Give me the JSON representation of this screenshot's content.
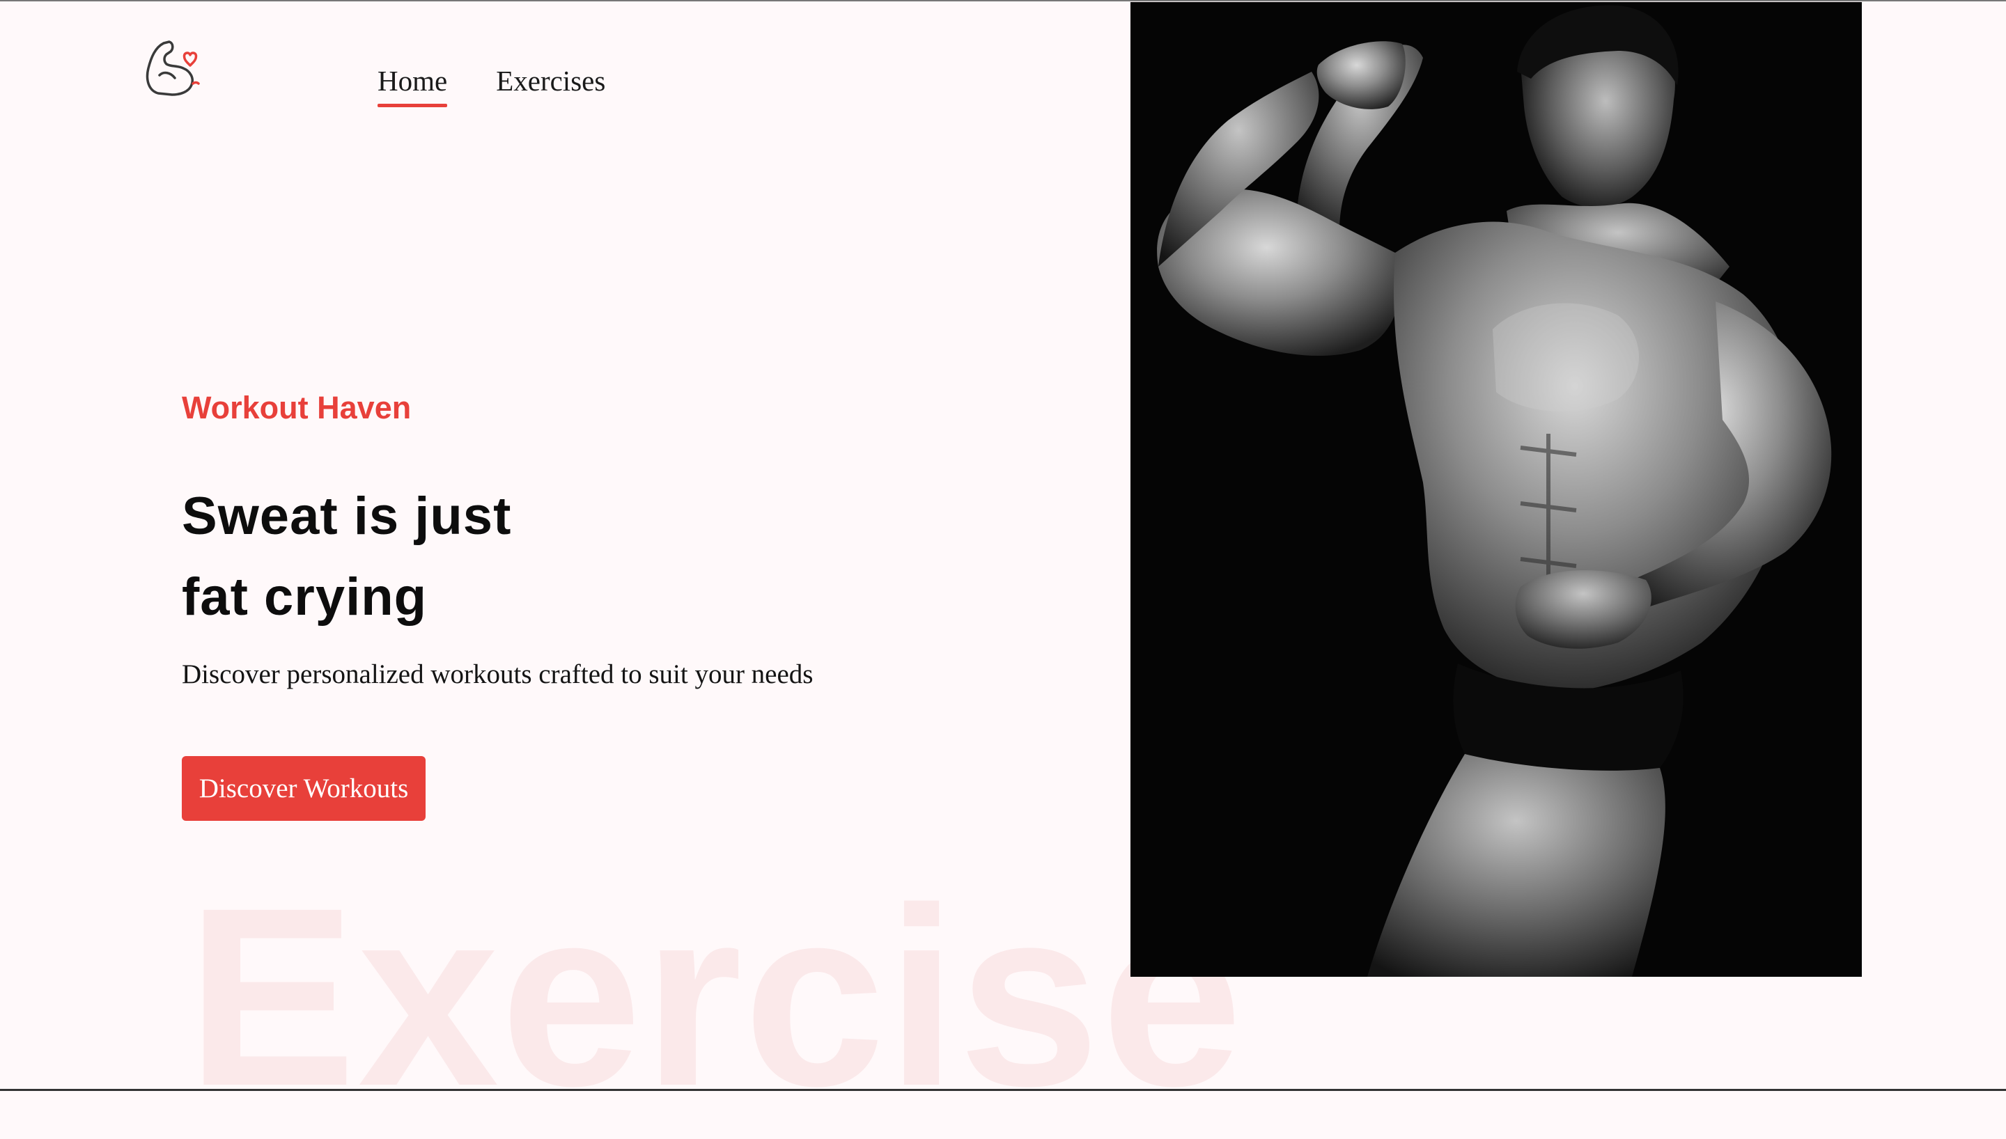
{
  "logo": {
    "icon": "flexed-bicep-heart-icon",
    "accent": "#e8403a"
  },
  "nav": {
    "items": [
      {
        "label": "Home",
        "active": true
      },
      {
        "label": "Exercises",
        "active": false
      }
    ]
  },
  "hero": {
    "brand": "Workout Haven",
    "headline_line1": "Sweat is just",
    "headline_line2": "fat crying",
    "subtitle": "Discover personalized workouts crafted to suit your needs",
    "cta_label": "Discover Workouts",
    "background_word": "Exercise",
    "image": "black-and-white bodybuilder flexing photo"
  },
  "colors": {
    "accent": "#e8403a",
    "background": "#fff9fa",
    "watermark": "#fbe9ea",
    "text": "#0d0d0d"
  }
}
